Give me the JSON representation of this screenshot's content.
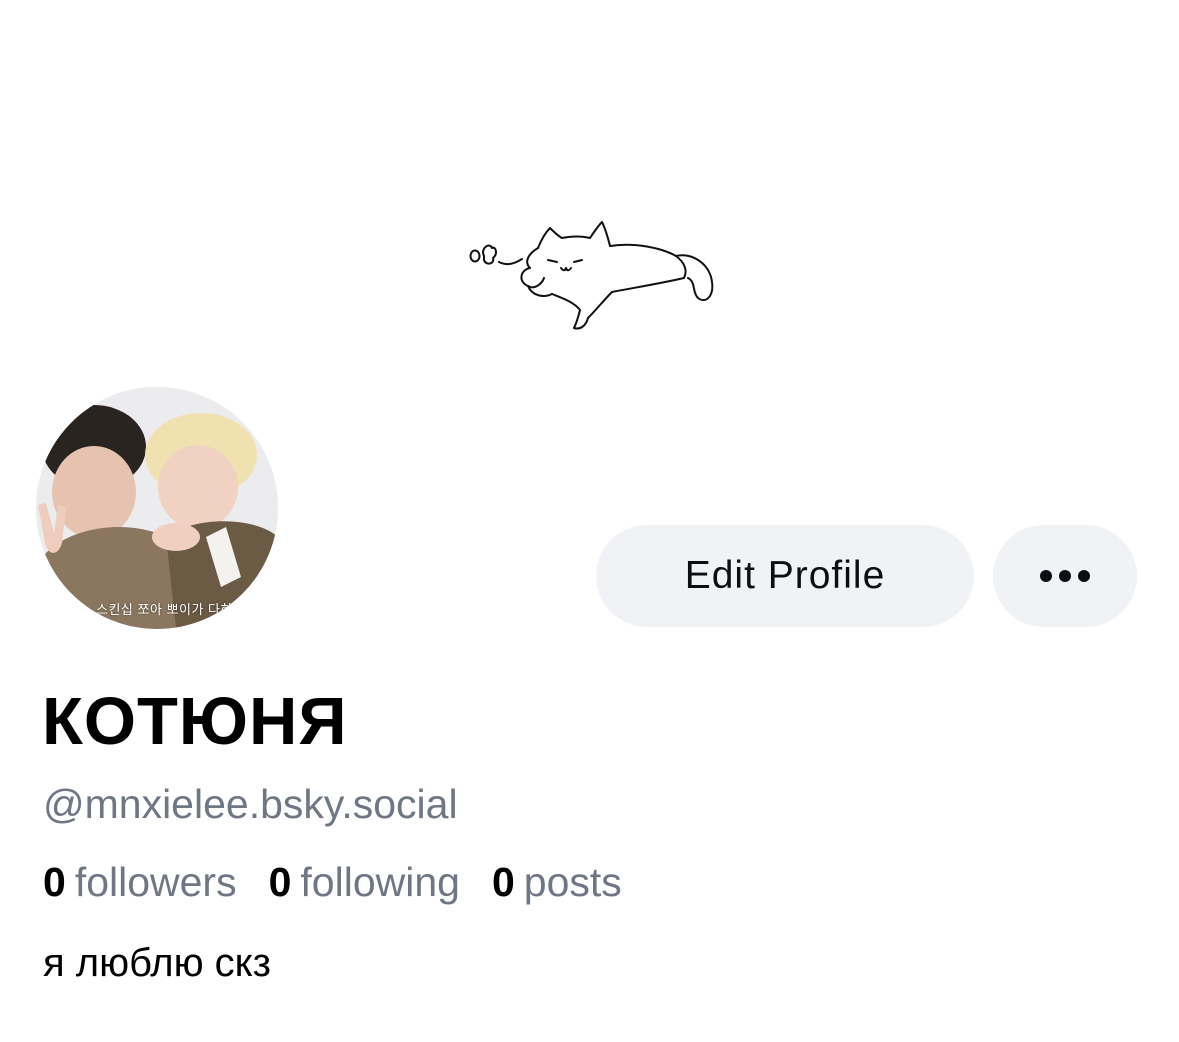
{
  "profile": {
    "display_name": "КОТЮНЯ",
    "handle": "@mnxielee.bsky.social",
    "bio": "я люблю скз",
    "avatar_caption": "스킨십 쪼아 뽀이가 다하는 거",
    "edit_profile_label": "Edit Profile",
    "more_icon": "more-horizontal-icon",
    "banner_icon": "sleeping-cat-doodle-icon"
  },
  "stats": [
    {
      "count": "0",
      "label": "followers"
    },
    {
      "count": "0",
      "label": "following"
    },
    {
      "count": "0",
      "label": "posts"
    }
  ],
  "colors": {
    "button_background": "#f1f2f5",
    "secondary_text": "#6f7785",
    "primary_text": "#000000"
  }
}
